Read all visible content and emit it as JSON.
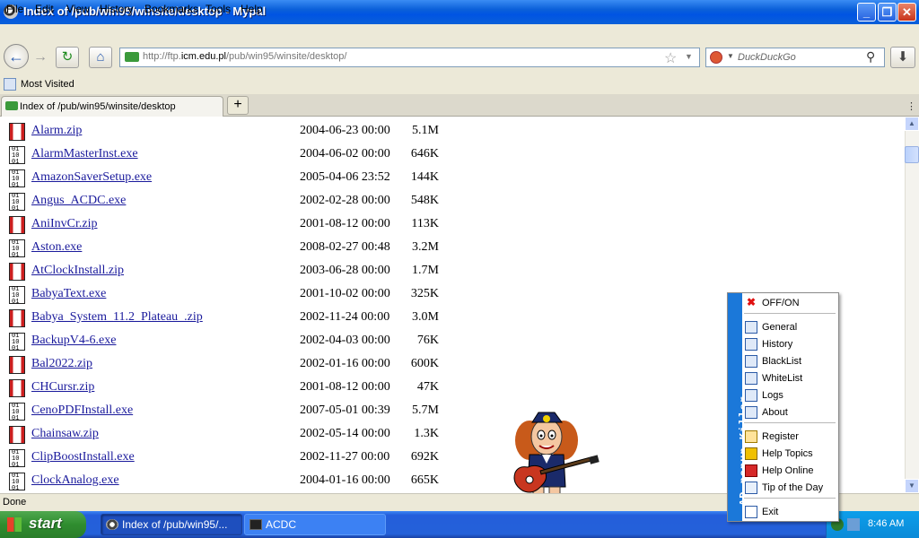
{
  "window": {
    "title": "Index of /pub/win95/winsite/desktop - Mypal",
    "min_glyph": "_",
    "max_glyph": "❐",
    "close_glyph": "✕"
  },
  "menu": [
    {
      "label": "File"
    },
    {
      "label": "Edit"
    },
    {
      "label": "View"
    },
    {
      "label": "History"
    },
    {
      "label": "Bookmarks"
    },
    {
      "label": "Tools"
    },
    {
      "label": "Help"
    }
  ],
  "nav": {
    "url_prefix": "http://ftp.",
    "url_host": "icm.edu.pl",
    "url_path": "/pub/win95/winsite/desktop/",
    "search_placeholder": "DuckDuckGo"
  },
  "bookmarks": {
    "most_visited": "Most Visited"
  },
  "tabs": [
    {
      "label": "Index of /pub/win95/winsite/desktop",
      "active": true
    }
  ],
  "files": [
    {
      "name": "Alarm.zip",
      "date": "2004-06-23 00:00",
      "size": "5.1M",
      "type": "zip"
    },
    {
      "name": "AlarmMasterInst.exe",
      "date": "2004-06-02 00:00",
      "size": "646K",
      "type": "exe"
    },
    {
      "name": "AmazonSaverSetup.exe",
      "date": "2005-04-06 23:52",
      "size": "144K",
      "type": "exe"
    },
    {
      "name": "Angus_ACDC.exe",
      "date": "2002-02-28 00:00",
      "size": "548K",
      "type": "exe"
    },
    {
      "name": "AniInvCr.zip",
      "date": "2001-08-12 00:00",
      "size": "113K",
      "type": "zip"
    },
    {
      "name": "Aston.exe",
      "date": "2008-02-27 00:48",
      "size": "3.2M",
      "type": "exe"
    },
    {
      "name": "AtClockInstall.zip",
      "date": "2003-06-28 00:00",
      "size": "1.7M",
      "type": "zip"
    },
    {
      "name": "BabyaText.exe",
      "date": "2001-10-02 00:00",
      "size": "325K",
      "type": "exe"
    },
    {
      "name": "Babya_System_11.2_Plateau_.zip",
      "date": "2002-11-24 00:00",
      "size": "3.0M",
      "type": "zip"
    },
    {
      "name": "BackupV4-6.exe",
      "date": "2002-04-03 00:00",
      "size": "76K",
      "type": "exe"
    },
    {
      "name": "Bal2022.zip",
      "date": "2002-01-16 00:00",
      "size": "600K",
      "type": "zip"
    },
    {
      "name": "CHCursr.zip",
      "date": "2001-08-12 00:00",
      "size": "47K",
      "type": "zip"
    },
    {
      "name": "CenoPDFInstall.exe",
      "date": "2007-05-01 00:39",
      "size": "5.7M",
      "type": "exe"
    },
    {
      "name": "Chainsaw.zip",
      "date": "2002-05-14 00:00",
      "size": "1.3K",
      "type": "zip"
    },
    {
      "name": "ClipBoostInstall.exe",
      "date": "2002-11-27 00:00",
      "size": "692K",
      "type": "exe"
    },
    {
      "name": "ClockAnalog.exe",
      "date": "2004-01-16 00:00",
      "size": "665K",
      "type": "exe"
    }
  ],
  "exe_icon_glyph": "01\n10\n01",
  "status": {
    "text": "Done"
  },
  "taskbar": {
    "start": "start",
    "tasks": [
      {
        "label": "Index of /pub/win95/..."
      },
      {
        "label": "ACDC"
      }
    ],
    "clock": "8:46 AM"
  },
  "popup": {
    "brand": "AD popup Killer",
    "groups": [
      [
        {
          "label": "OFF/ON",
          "icon": "x"
        }
      ],
      [
        {
          "label": "General",
          "icon": "win"
        },
        {
          "label": "History",
          "icon": "win"
        },
        {
          "label": "BlackList",
          "icon": "win"
        },
        {
          "label": "WhiteList",
          "icon": "win"
        },
        {
          "label": "Logs",
          "icon": "win"
        },
        {
          "label": "About",
          "icon": "win"
        }
      ],
      [
        {
          "label": "Register",
          "icon": "key"
        },
        {
          "label": "Help Topics",
          "icon": "help"
        },
        {
          "label": "Help Online",
          "icon": "web"
        },
        {
          "label": "Tip of the Day",
          "icon": "tip"
        }
      ],
      [
        {
          "label": "Exit",
          "icon": "exit"
        }
      ]
    ]
  },
  "colors": {
    "title_bar": "#0054e3",
    "link": "#1a1a9c",
    "popup_stripe": "#1b78d9",
    "taskbar": "#245edb",
    "start": "#2f8d2f"
  }
}
